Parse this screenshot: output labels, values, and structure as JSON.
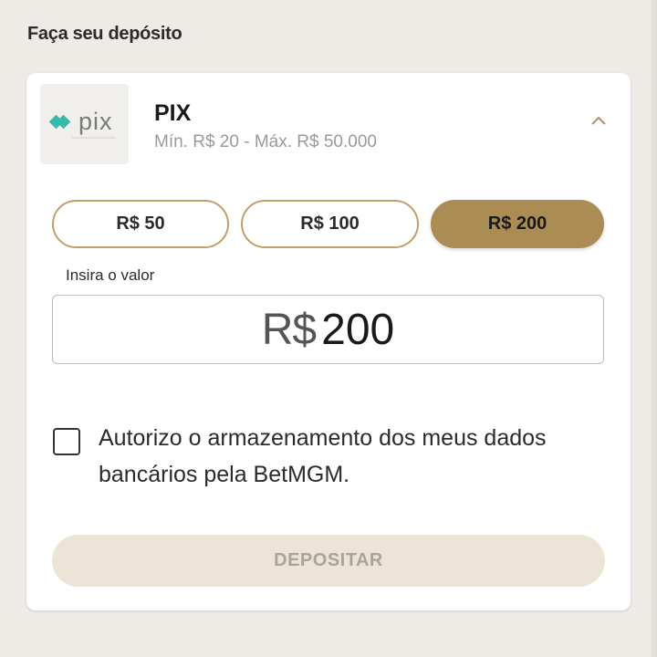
{
  "page": {
    "title": "Faça seu depósito"
  },
  "payment_method": {
    "name": "PIX",
    "limits": "Mín. R$ 20 - Máx. R$ 50.000",
    "logo_icon": "pix-logo-icon",
    "logo_text": "pix",
    "expand_icon": "chevron-up-icon",
    "brand_color": "#32bcad"
  },
  "quick_amounts": [
    {
      "label": "R$ 50",
      "selected": false
    },
    {
      "label": "R$ 100",
      "selected": false
    },
    {
      "label": "R$ 200",
      "selected": true
    }
  ],
  "amount_input": {
    "label": "Insira o valor",
    "currency": "R$",
    "value": "200"
  },
  "consent": {
    "checked": false,
    "text": "Autorizo o armazenamento dos meus dados bancários pela BetMGM."
  },
  "deposit_button": {
    "label": "DEPOSITAR",
    "enabled": false
  },
  "colors": {
    "accent_gold": "#ac8c55",
    "accent_border": "#c0a06a",
    "disabled_bg": "#ece4d7"
  }
}
